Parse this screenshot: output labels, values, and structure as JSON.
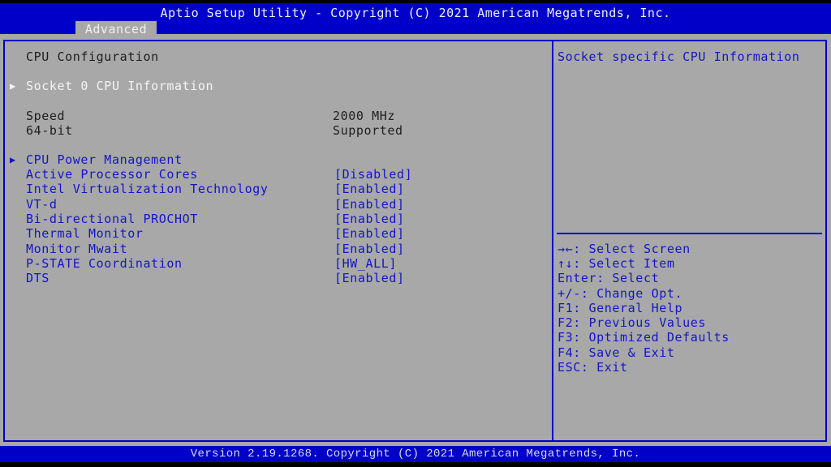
{
  "header": {
    "title": "Aptio Setup Utility - Copyright (C) 2021 American Megatrends, Inc.",
    "active_tab": "Advanced"
  },
  "main": {
    "section_title": "CPU Configuration",
    "submenu_socket": "Socket 0 CPU Information",
    "info": [
      {
        "label": "Speed",
        "value": "2000 MHz"
      },
      {
        "label": "64-bit",
        "value": "Supported"
      }
    ],
    "submenu_power": "CPU Power Management",
    "settings": [
      {
        "label": "Active Processor Cores",
        "value": "[Disabled]"
      },
      {
        "label": "Intel Virtualization Technology",
        "value": "[Enabled]"
      },
      {
        "label": "VT-d",
        "value": "[Enabled]"
      },
      {
        "label": "Bi-directional PROCHOT",
        "value": "[Enabled]"
      },
      {
        "label": "Thermal Monitor",
        "value": "[Enabled]"
      },
      {
        "label": "Monitor Mwait",
        "value": "[Enabled]"
      },
      {
        "label": "P-STATE Coordination",
        "value": "[HW_ALL]"
      },
      {
        "label": "DTS",
        "value": "[Enabled]"
      }
    ]
  },
  "help": {
    "description": "Socket specific CPU Information",
    "keys": [
      "→←: Select Screen",
      "↑↓: Select Item",
      "Enter: Select",
      "+/-: Change Opt.",
      "F1: General Help",
      "F2: Previous Values",
      "F3: Optimized Defaults",
      "F4: Save & Exit",
      "ESC: Exit"
    ]
  },
  "footer": {
    "version": "Version 2.19.1268. Copyright (C) 2021 American Megatrends, Inc."
  },
  "icons": {
    "submenu_arrow": "▶"
  },
  "colors": {
    "header_bg": "#0000c8",
    "panel_bg": "#a8a8a8",
    "selectable_text": "#1414c8",
    "highlight_text": "#f4f4f4"
  }
}
